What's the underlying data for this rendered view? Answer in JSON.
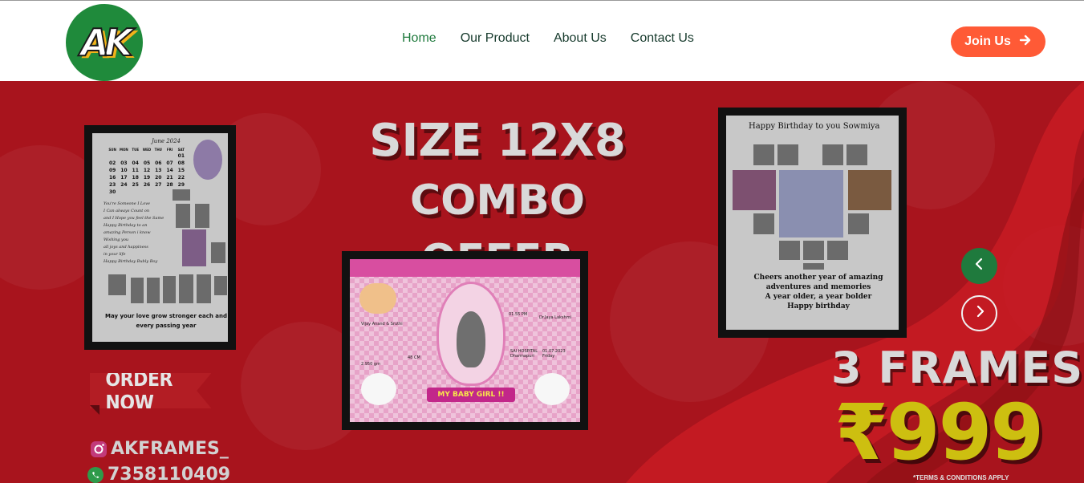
{
  "header": {
    "logo_text": "AK",
    "nav": [
      {
        "label": "Home",
        "active": true
      },
      {
        "label": "Our Product",
        "active": false
      },
      {
        "label": "About Us",
        "active": false
      },
      {
        "label": "Contact Us",
        "active": false
      }
    ],
    "join_label": "Join Us"
  },
  "hero": {
    "headline_1": "SIZE 12X8",
    "headline_2": "COMBO OFFER",
    "order_now": "ORDER NOW",
    "instagram": "AKFRAMES_",
    "whatsapp": "7358110409",
    "frames": "3 FRAMES",
    "price": "₹999",
    "terms": "*TERMS & CONDITIONS APPLY",
    "calendar": {
      "title": "June 2024",
      "days": [
        "SUN",
        "MON",
        "TUE",
        "WED",
        "THU",
        "FRI",
        "SAT"
      ],
      "dates": [
        "",
        "",
        "",
        "",
        "",
        "",
        "01",
        "02",
        "03",
        "04",
        "05",
        "06",
        "07",
        "08",
        "09",
        "10",
        "11",
        "12",
        "13",
        "14",
        "15",
        "16",
        "17",
        "18",
        "19",
        "20",
        "21",
        "22",
        "23",
        "24",
        "25",
        "26",
        "27",
        "28",
        "29",
        "30",
        "",
        "",
        "",
        "",
        "",
        ""
      ],
      "message_lines": [
        "You're Someone I Love",
        "I Can always Count on",
        "and I Hope you feel the Same",
        "Happy Birthday to an",
        "amazing Person i know",
        "Wishing you",
        "all joys and happiness",
        "in your life",
        "Happy Birthday Bubly Boy"
      ],
      "footer_1": "May your love grow stronger each and",
      "footer_2": "every passing year"
    },
    "baby": {
      "banner": "MY BABY GIRL !!",
      "names": "Vijay Anand & Sruthi",
      "time": "01.55 PM",
      "doctor": "Dr.Jaya Lakshmi",
      "hospital": "SAI HOSPITAL Dharmapuri",
      "date": "01.07.2023 Friday",
      "weight": "2.950 gm",
      "length": "48 CM"
    },
    "birthday": {
      "title": "Happy Birthday  to you Sowmiya",
      "footer": [
        "Cheers another year of amazing",
        "adventures and memories",
        "A year older, a year bolder",
        "Happy birthday"
      ]
    }
  },
  "colors": {
    "hero_red": "#a8141d",
    "join_orange": "#ff5a36",
    "nav_active_green": "#1f7a3d",
    "price_yellow": "#cdbf10"
  },
  "icons": {
    "join": "arrow-right-icon",
    "prev": "chevron-left-icon",
    "next": "chevron-right-icon",
    "instagram": "instagram-icon",
    "whatsapp": "whatsapp-icon"
  }
}
